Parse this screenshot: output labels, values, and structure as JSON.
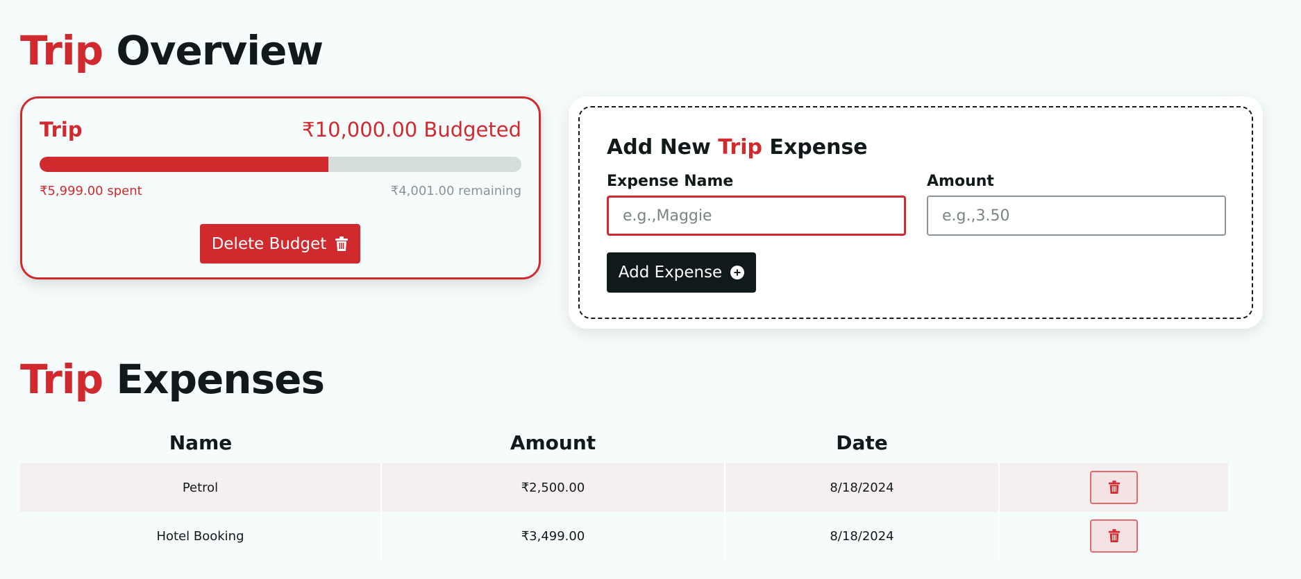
{
  "overview": {
    "title_accent": "Trip",
    "title_rest": "Overview"
  },
  "budget": {
    "name": "Trip",
    "budgeted_text": "₹10,000.00 Budgeted",
    "spent_text": "₹5,999.00 spent",
    "remaining_text": "₹4,001.00 remaining",
    "progress_fraction": 0.6,
    "delete_label": "Delete Budget"
  },
  "form": {
    "title_start": "Add New",
    "title_accent": "Trip",
    "title_end": "Expense",
    "name_label": "Expense Name",
    "name_placeholder": "e.g.,Maggie",
    "amount_label": "Amount",
    "amount_placeholder": "e.g.,3.50",
    "submit_label": "Add Expense"
  },
  "expenses": {
    "title_accent": "Trip",
    "title_rest": "Expenses",
    "columns": [
      "Name",
      "Amount",
      "Date",
      ""
    ],
    "rows": [
      {
        "name": "Petrol",
        "amount": "₹2,500.00",
        "date": "8/18/2024"
      },
      {
        "name": "Hotel Booking",
        "amount": "₹3,499.00",
        "date": "8/18/2024"
      }
    ]
  },
  "colors": {
    "accent": "#d02a2f",
    "dark": "#111a1a",
    "background": "#f6fbfb"
  },
  "icons": {
    "delete": "trash-icon",
    "add": "plus-circle-icon"
  }
}
